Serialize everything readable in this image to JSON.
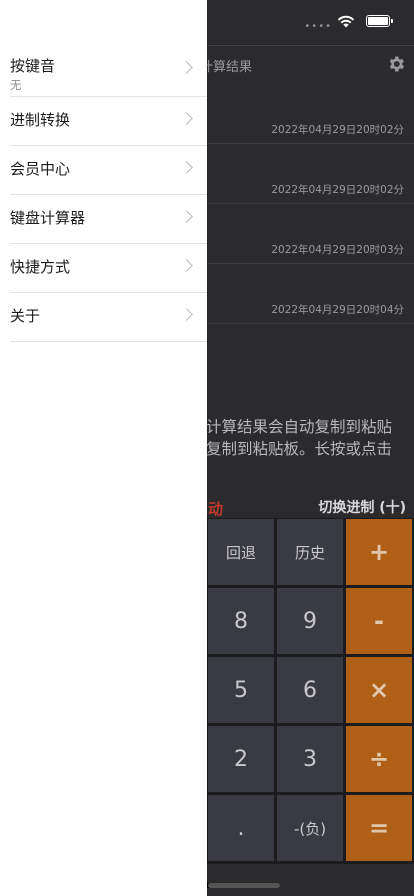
{
  "history": {
    "title": "计算结果",
    "rows": [
      {
        "time": "2022年04月29日20时02分"
      },
      {
        "time": "2022年04月29日20时02分"
      },
      {
        "time": "2022年04月29日20时03分"
      },
      {
        "time": "2022年04月29日20时04分"
      }
    ]
  },
  "tips": {
    "line1": "计算结果会自动复制到粘贴",
    "line2": "复制到粘贴板。长按或点击"
  },
  "toolbar": {
    "red_glyph": "动",
    "base_switch": "切换进制 (十)"
  },
  "keys": {
    "backspace": "回退",
    "history": "历史",
    "plus": "+",
    "k8": "8",
    "k9": "9",
    "minus": "-",
    "k5": "5",
    "k6": "6",
    "multiply": "×",
    "k2": "2",
    "k3": "3",
    "divide": "÷",
    "dot": ".",
    "negate": "-(负)",
    "equals": "="
  },
  "drawer": {
    "items": [
      {
        "label": "按键音",
        "sub": "无"
      },
      {
        "label": "进制转换"
      },
      {
        "label": "会员中心"
      },
      {
        "label": "键盘计算器"
      },
      {
        "label": "快捷方式"
      },
      {
        "label": "关于"
      }
    ]
  },
  "status": {
    "dots": "••••"
  }
}
